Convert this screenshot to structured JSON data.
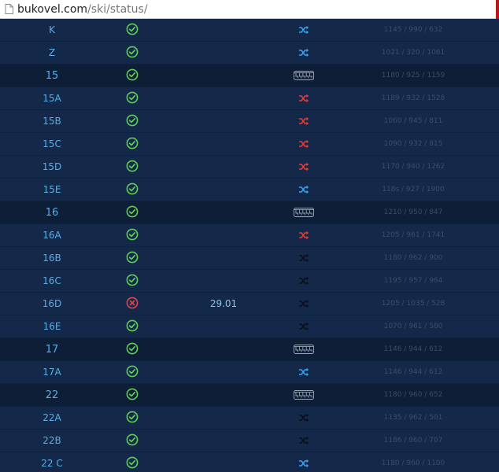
{
  "browser": {
    "host": "bukovel.com",
    "path": "/ski/status/"
  },
  "colors": {
    "open": "#5fcf55",
    "closed": "#e0454f",
    "icon_blue": "#3aa0ea",
    "icon_red": "#e43b3b",
    "icon_black": "#0a0f18",
    "icon_gray": "#9aa7b8"
  },
  "rows": [
    {
      "name": "K",
      "status": "open",
      "date": "",
      "type": "blue",
      "elev": "1145 / 990 / 632"
    },
    {
      "name": "Z",
      "status": "open",
      "date": "",
      "type": "blue",
      "elev": "1021 / 320 / 1061"
    },
    {
      "name": "15",
      "status": "open",
      "date": "",
      "type": "lift",
      "elev": "1180 / 925 / 1159"
    },
    {
      "name": "15A",
      "status": "open",
      "date": "",
      "type": "red",
      "elev": "1189 / 932 / 1528"
    },
    {
      "name": "15B",
      "status": "open",
      "date": "",
      "type": "red",
      "elev": "1060 / 945 / 811"
    },
    {
      "name": "15C",
      "status": "open",
      "date": "",
      "type": "red",
      "elev": "1090 / 932 / 815"
    },
    {
      "name": "15D",
      "status": "open",
      "date": "",
      "type": "red",
      "elev": "1170 / 940 / 1262"
    },
    {
      "name": "15E",
      "status": "open",
      "date": "",
      "type": "blue",
      "elev": "118s / 927 / 1900"
    },
    {
      "name": "16",
      "status": "open",
      "date": "",
      "type": "lift",
      "elev": "1210 / 950 / 847"
    },
    {
      "name": "16A",
      "status": "open",
      "date": "",
      "type": "red",
      "elev": "1205 / 961 / 1741"
    },
    {
      "name": "16B",
      "status": "open",
      "date": "",
      "type": "black",
      "elev": "1180 / 962 / 900"
    },
    {
      "name": "16C",
      "status": "open",
      "date": "",
      "type": "black",
      "elev": "1195 / 957 / 964"
    },
    {
      "name": "16D",
      "status": "closed",
      "date": "29.01",
      "type": "black",
      "elev": "1205 / 1035 / 528"
    },
    {
      "name": "16E",
      "status": "open",
      "date": "",
      "type": "black",
      "elev": "1070 / 961 / 580"
    },
    {
      "name": "17",
      "status": "open",
      "date": "",
      "type": "lift",
      "elev": "1146 / 944 / 612"
    },
    {
      "name": "17A",
      "status": "open",
      "date": "",
      "type": "blue",
      "elev": "1146 / 944 / 612"
    },
    {
      "name": "22",
      "status": "open",
      "date": "",
      "type": "lift",
      "elev": "1180 / 960 / 652"
    },
    {
      "name": "22A",
      "status": "open",
      "date": "",
      "type": "black",
      "elev": "1135 / 962 / 501"
    },
    {
      "name": "22B",
      "status": "open",
      "date": "",
      "type": "black",
      "elev": "1186 / 960 / 707"
    },
    {
      "name": "22 C",
      "status": "open",
      "date": "",
      "type": "blue",
      "elev": "1180 / 960 / 1100"
    }
  ]
}
